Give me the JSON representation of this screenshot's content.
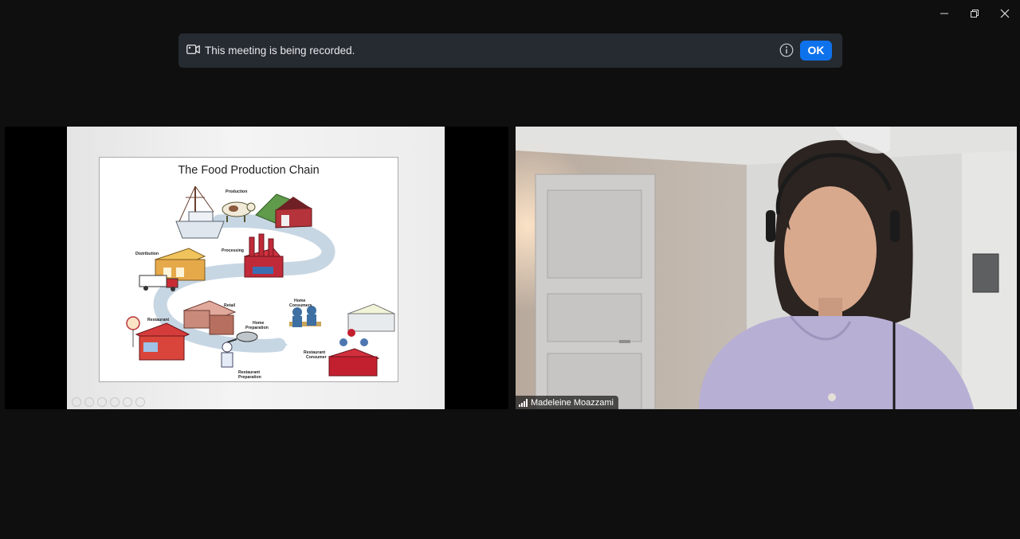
{
  "recording_banner": {
    "message": "This meeting is being recorded.",
    "ok_label": "OK",
    "icon": "video-camera-icon",
    "info_icon": "info-icon"
  },
  "window_controls": [
    "minimize-icon",
    "restore-icon",
    "close-icon"
  ],
  "shared_slide": {
    "title": "The Food Production Chain",
    "labels": {
      "production": "Production",
      "processing": "Processing",
      "distribution": "Distribution",
      "retail": "Retail",
      "home_consumers_1": "Home",
      "home_consumers_2": "Consumers",
      "home_preparation_1": "Home",
      "home_preparation_2": "Preparation",
      "restaurant": "Restaurant",
      "restaurant_consumer_1": "Restaurant",
      "restaurant_consumer_2": "Consumer",
      "restaurant_preparation_1": "Restaurant",
      "restaurant_preparation_2": "Preparation"
    }
  },
  "participant": {
    "name": "Madeleine Moazzami",
    "icon": "signal-bars-icon"
  },
  "colors": {
    "accent": "#0e72ed",
    "banner_bg": "#262a31",
    "background": "#0f0f0f"
  }
}
